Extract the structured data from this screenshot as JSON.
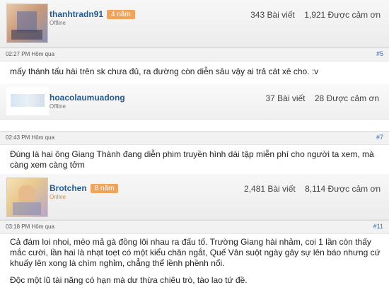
{
  "posts": [
    {
      "username": "thanhtradn91",
      "badge": "4 năm",
      "status": "Offline",
      "posts_count": "343 Bài viết",
      "thanks_count": "1,921 Được cảm ơn",
      "time": "02:27 PM Hôm qua",
      "post_number": "#5",
      "paragraphs": [
        "mấy thánh tấu hài trên sk chưa đủ, ra đường còn diễn sâu vậy ai trả cát xê cho. :v"
      ]
    },
    {
      "username": "hoacolaumuadong",
      "status": "Offline",
      "posts_count": "37 Bài viết",
      "thanks_count": "28 Được cảm ơn",
      "time": "02:43 PM Hôm qua",
      "post_number": "#7",
      "paragraphs": [
        "Đúng là hai ông Giang Thành đang diễn phim truyền hình dài tập miễn phí cho người ta xem, mà càng xem càng tởm"
      ]
    },
    {
      "username": "Brotchen",
      "badge": "8 năm",
      "status": "Online",
      "posts_count": "2,481 Bài viết",
      "thanks_count": "8,114 Được cảm ơn",
      "time": "03:18 PM Hôm qua",
      "post_number": "#11",
      "paragraphs": [
        "Cả đám loi nhoi, mèo mả gà đồng lôi nhau ra đấu tố. Trường Giang hài nhảm, coi 1 lần còn thấy mắc cười, lần hai là nhạt toẹt có một kiểu chăn ngắt, Quế Vân suột ngày gây sự lên báo nhưng cứ khuấy lên xong là chìm nghỉm, chẳng thể lềnh phềnh nổi.",
        "Độc một lũ tài năng có hạn mà dư thừa chiêu trò, tào lao tứ đề."
      ]
    }
  ]
}
